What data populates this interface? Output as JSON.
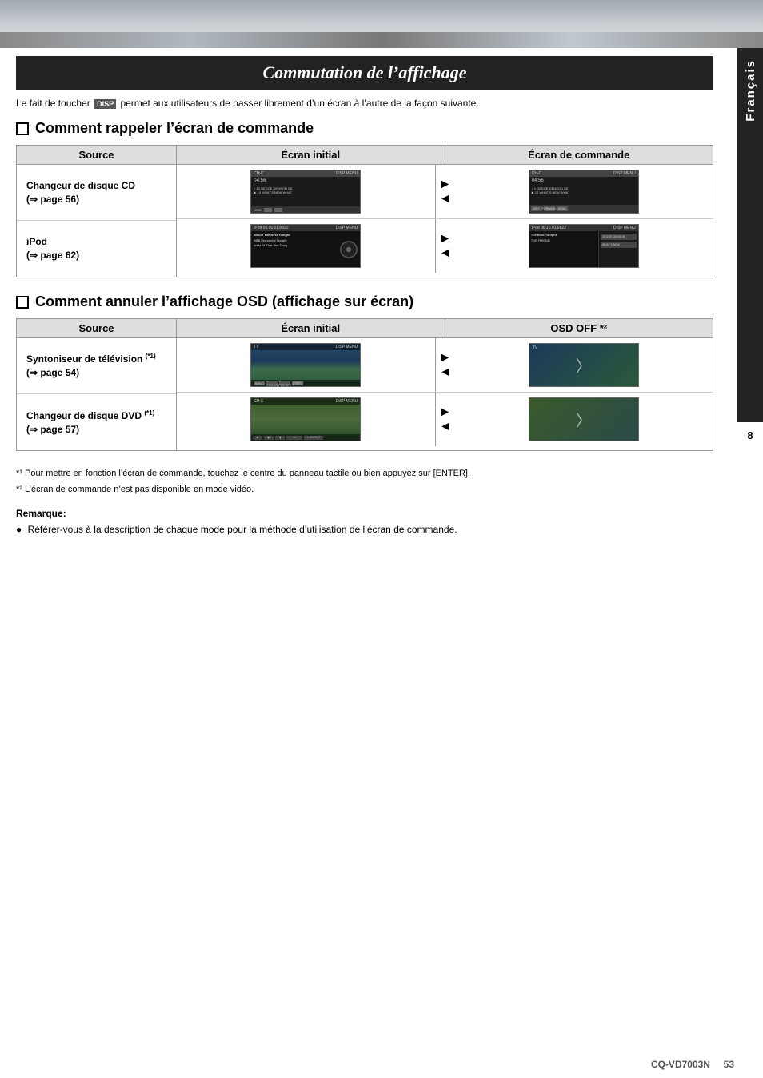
{
  "banner": {
    "alt": "road landscape banner"
  },
  "page_tab": {
    "language": "Français",
    "number": "8"
  },
  "title": "Commutation de l’affichage",
  "intro": {
    "pre": "Le fait de toucher",
    "badge": "DISP",
    "post": "permet aux utilisateurs de passer librement d’un écran à l’autre de la façon suivante."
  },
  "section1": {
    "heading": "Comment rappeler l’écran de commande",
    "headers": {
      "source": "Source",
      "initial": "Écran initial",
      "commande": "Écran de commande"
    },
    "rows": [
      {
        "source_label": "Changeur de disque CD\n(⇒ page 56)"
      },
      {
        "source_label": "iPod\n(⇒ page 62)"
      }
    ]
  },
  "section2": {
    "heading": "Comment annuler l’affichage OSD (affichage sur écran)",
    "headers": {
      "source": "Source",
      "initial": "Écran initial",
      "osd": "OSD OFF *²"
    },
    "rows": [
      {
        "source_label": "Syntoniseur de télévision (*1)\n(⇒ page 54)"
      },
      {
        "source_label": "Changeur de disque DVD (*1)\n(⇒ page 57)"
      }
    ]
  },
  "footnotes": {
    "fn1": "*¹ Pour mettre en fonction l’écran de commande, touchez le centre du panneau tactile ou bien appuyez sur [ENTER].",
    "fn2": "*² L’écran de commande n’est pas disponible en mode vidéo."
  },
  "remark": {
    "title": "Remarque:",
    "text": "Référer-vous à la description de chaque mode pour la méthode d’utilisation de l’écran de commande."
  },
  "footer": {
    "model": "CQ-VD7003N",
    "page": "53"
  }
}
